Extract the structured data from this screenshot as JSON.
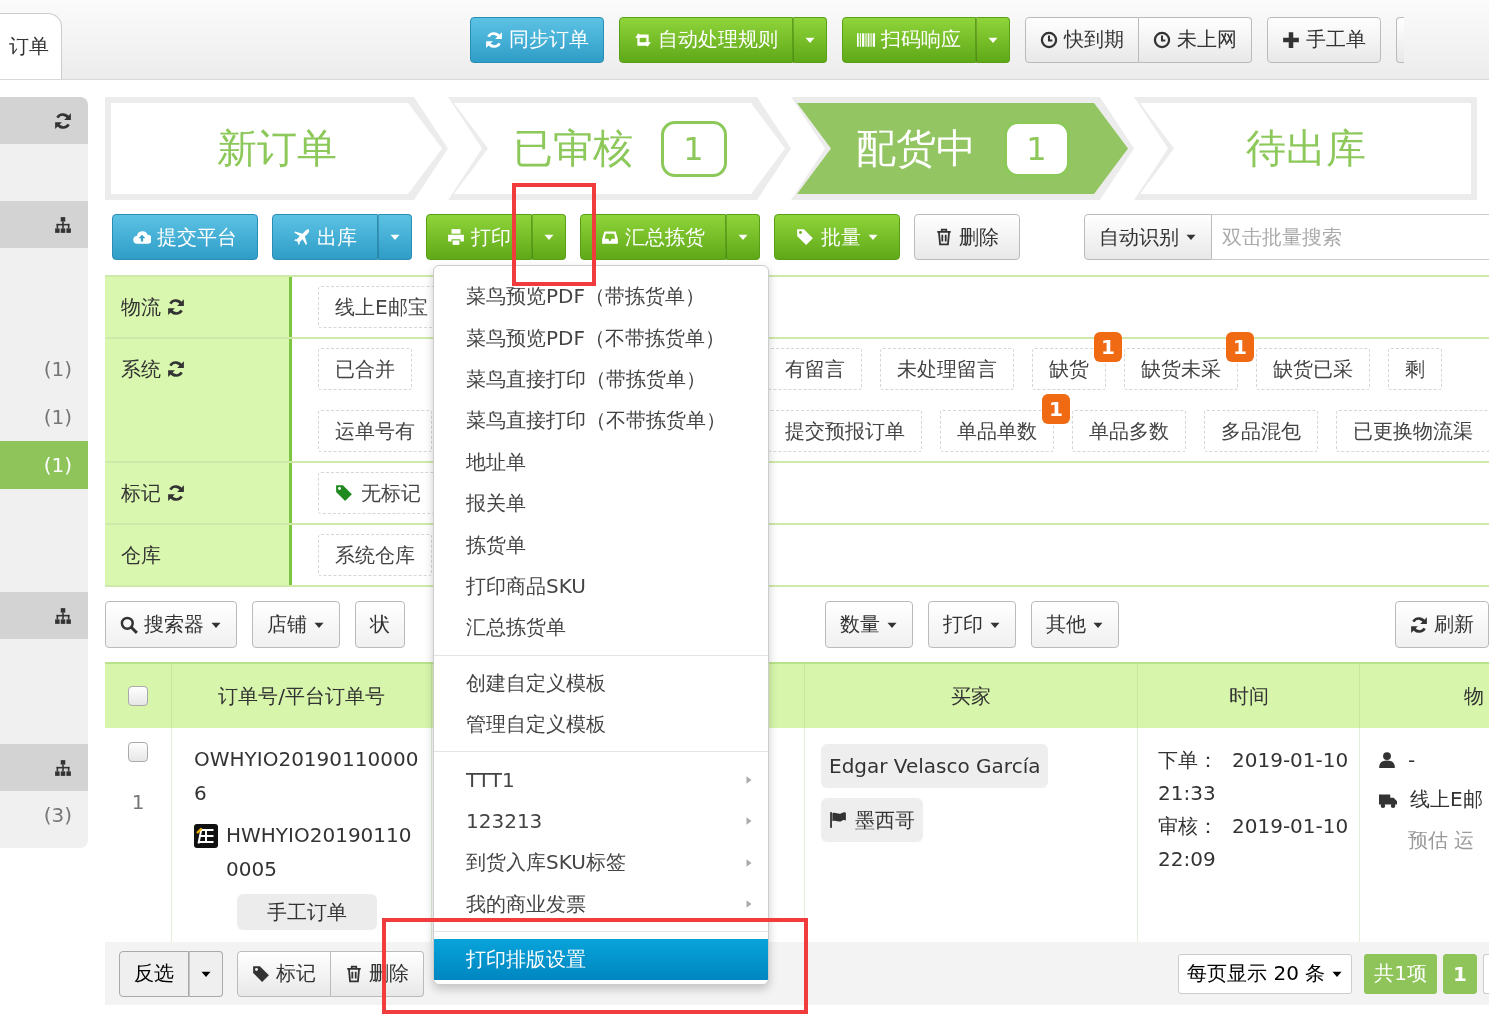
{
  "top_tab": {
    "label": "订单"
  },
  "top_buttons": [
    {
      "kind": "primary",
      "label": "同步订单",
      "split": false
    },
    {
      "kind": "success",
      "label": "自动处理规则",
      "split": true
    },
    {
      "kind": "success",
      "label": "扫码响应",
      "split": true
    },
    {
      "kind": "group",
      "items": [
        {
          "label": "快到期"
        },
        {
          "label": "未上网"
        }
      ]
    },
    {
      "kind": "default",
      "label": "手工单",
      "split": false
    }
  ],
  "sidebar": {
    "sections": [
      {
        "counts": [
          {
            "text": "(1)",
            "selected": false
          },
          {
            "text": "(1)",
            "selected": false
          },
          {
            "text": "(1)",
            "selected": true
          }
        ]
      },
      {
        "counts": [
          {
            "text": "(3)",
            "selected": false
          }
        ]
      }
    ]
  },
  "steps": [
    {
      "label": "新订单",
      "selected": false
    },
    {
      "label": "已审核",
      "count": "1",
      "selected": false
    },
    {
      "label": "配货中",
      "count": "1",
      "selected": true
    },
    {
      "label": "待出库",
      "selected": false
    }
  ],
  "actions": [
    {
      "label": "提交平台",
      "kind": "primary",
      "split": false,
      "caret": false
    },
    {
      "label": "出库",
      "kind": "primary",
      "split": true,
      "caret": false
    },
    {
      "label": "打印",
      "kind": "success",
      "split": true,
      "caret": false
    },
    {
      "label": "汇总拣货",
      "kind": "success",
      "split": true,
      "caret": false
    },
    {
      "label": "批量",
      "kind": "success",
      "split": false,
      "caret": true
    },
    {
      "label": "删除",
      "kind": "default",
      "split": false,
      "caret": false
    }
  ],
  "search": {
    "mode": "自动识别",
    "placeholder": "双击批量搜索"
  },
  "filters": [
    {
      "label": "物流",
      "refresh": true,
      "lines": [
        {
          "left": [
            {
              "text": "线上E邮宝",
              "kind": "plain"
            }
          ]
        }
      ]
    },
    {
      "label": "系统",
      "refresh": true,
      "lines": [
        {
          "left": [
            {
              "text": "已合并",
              "kind": "plain"
            }
          ],
          "right": [
            {
              "text": "有留言",
              "kind": "plain"
            },
            {
              "text": "未处理留言",
              "kind": "plain"
            },
            {
              "text": "缺货",
              "kind": "plain",
              "badge": "1"
            },
            {
              "text": "缺货未采",
              "kind": "plain",
              "badge": "1"
            },
            {
              "text": "缺货已采",
              "kind": "plain"
            },
            {
              "text": "剩",
              "kind": "plain"
            }
          ]
        },
        {
          "left": [
            {
              "text": "运单号有",
              "kind": "plain"
            }
          ],
          "right": [
            {
              "text": "提交预报订单",
              "kind": "plain"
            },
            {
              "text": "单品单数",
              "kind": "plain",
              "badge": "1"
            },
            {
              "text": "单品多数",
              "kind": "plain"
            },
            {
              "text": "多品混包",
              "kind": "plain"
            },
            {
              "text": "已更换物流渠",
              "kind": "plain"
            }
          ]
        }
      ]
    },
    {
      "label": "标记",
      "refresh": true,
      "lines": [
        {
          "left": [
            {
              "text": "无标记",
              "kind": "marker"
            }
          ]
        }
      ]
    },
    {
      "label": "仓库",
      "refresh": false,
      "lines": [
        {
          "left": [
            {
              "text": "系统仓库",
              "kind": "plain"
            }
          ]
        }
      ]
    }
  ],
  "filter_buttons": {
    "left": [
      {
        "label": "搜索器",
        "caret": true
      },
      {
        "label": "店铺",
        "caret": true
      },
      {
        "label": "状",
        "caret": false
      }
    ],
    "right": [
      {
        "label": "数量",
        "caret": true
      },
      {
        "label": "打印",
        "caret": true
      },
      {
        "label": "其他",
        "caret": true
      }
    ],
    "refresh": {
      "label": "刷新"
    }
  },
  "table": {
    "header_checked": false,
    "columns": [
      "订单号/平台订单号",
      "买家",
      "时间",
      "物"
    ],
    "rows": [
      {
        "checked": false,
        "index": "1",
        "order_no": "OWHYIO201901100006",
        "platform_no": "HWHYIO201901100005",
        "order_type": "手工订单",
        "buyer": "Edgar Velasco García",
        "country": "墨西哥",
        "times": [
          {
            "label": "下单：",
            "value": "2019-01-10 21:33"
          },
          {
            "label": "审核：",
            "value": "2019-01-10 22:09"
          }
        ],
        "recipient": "-",
        "carrier": "线上E邮",
        "freight": "预估 运"
      }
    ]
  },
  "bulk_bar": {
    "buttons": [
      {
        "kind": "single",
        "label": "反选",
        "split": true
      },
      {
        "kind": "group",
        "items": [
          {
            "label": "标记"
          },
          {
            "label": "删除"
          }
        ]
      }
    ]
  },
  "pagination": {
    "page_size": "每页显示 20 条",
    "total": "共1项",
    "pages": [
      {
        "label": "1",
        "selected": true
      }
    ]
  },
  "menu": {
    "groups": [
      {
        "items": [
          {
            "label": "菜鸟预览PDF（带拣货单）",
            "submenu": false,
            "selected": false
          },
          {
            "label": "菜鸟预览PDF（不带拣货单）",
            "submenu": false,
            "selected": false
          },
          {
            "label": "菜鸟直接打印（带拣货单）",
            "submenu": false,
            "selected": false
          },
          {
            "label": "菜鸟直接打印（不带拣货单）",
            "submenu": false,
            "selected": false
          },
          {
            "label": "地址单",
            "submenu": false,
            "selected": false
          },
          {
            "label": "报关单",
            "submenu": false,
            "selected": false
          },
          {
            "label": "拣货单",
            "submenu": false,
            "selected": false
          },
          {
            "label": "打印商品SKU",
            "submenu": false,
            "selected": false
          },
          {
            "label": "汇总拣货单",
            "submenu": false,
            "selected": false
          }
        ]
      },
      {
        "items": [
          {
            "label": "创建自定义模板",
            "submenu": false,
            "selected": false
          },
          {
            "label": "管理自定义模板",
            "submenu": false,
            "selected": false
          }
        ]
      },
      {
        "items": [
          {
            "label": "TTT1",
            "submenu": true,
            "selected": false
          },
          {
            "label": "123213",
            "submenu": true,
            "selected": false
          },
          {
            "label": "到货入库SKU标签",
            "submenu": true,
            "selected": false
          },
          {
            "label": "我的商业发票",
            "submenu": true,
            "selected": false
          }
        ]
      },
      {
        "items": [
          {
            "label": "打印排版设置",
            "submenu": false,
            "selected": true
          }
        ]
      }
    ]
  }
}
